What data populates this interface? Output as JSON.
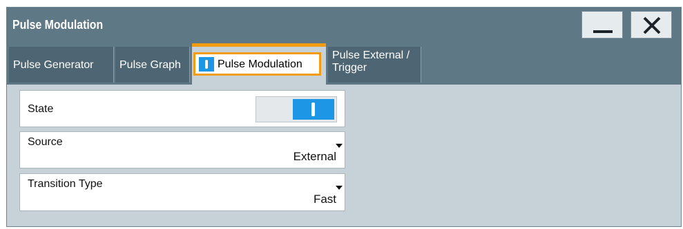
{
  "window": {
    "title": "Pulse Modulation"
  },
  "tabs": [
    {
      "label": "Pulse Generator"
    },
    {
      "label": "Pulse Graph"
    },
    {
      "label": "Pulse Modulation",
      "active": true,
      "state_icon": "on-indicator-icon"
    },
    {
      "label": "Pulse External / Trigger"
    }
  ],
  "fields": {
    "state": {
      "label": "State",
      "value": "on"
    },
    "source": {
      "label": "Source",
      "value": "External"
    },
    "transition": {
      "label": "Transition Type",
      "value": "Fast"
    }
  },
  "colors": {
    "accent": "#f39c12",
    "toggle_on": "#1e96e6",
    "titlebar": "#5f7886",
    "panel": "#c7d2d8"
  }
}
